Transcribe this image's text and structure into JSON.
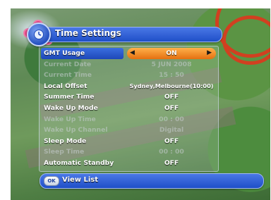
{
  "title": "Time Settings",
  "rows": [
    {
      "label": "GMT Usage",
      "value": "ON",
      "state": "selected"
    },
    {
      "label": "Current Date",
      "value": "5 JUN 2008",
      "state": "disabled"
    },
    {
      "label": "Current Time",
      "value": "15 : 50",
      "state": "disabled"
    },
    {
      "label": "Local Offset",
      "value": "Sydney,Melbourne(10:00)",
      "state": "normal"
    },
    {
      "label": "Summer Time",
      "value": "OFF",
      "state": "normal"
    },
    {
      "label": "Wake Up Mode",
      "value": "OFF",
      "state": "normal"
    },
    {
      "label": "Wake Up Time",
      "value": "00 : 00",
      "state": "disabled"
    },
    {
      "label": "Wake Up Channel",
      "value": "Digital",
      "state": "disabled"
    },
    {
      "label": "Sleep Mode",
      "value": "OFF",
      "state": "normal"
    },
    {
      "label": "Sleep Time",
      "value": "00 : 00",
      "state": "disabled"
    },
    {
      "label": "Automatic Standby",
      "value": "OFF",
      "state": "normal"
    }
  ],
  "footer": {
    "button_label": "OK",
    "action_label": "View List"
  },
  "icons": {
    "title": "clock-settings-icon",
    "left_arrow": "left-arrow-icon",
    "right_arrow": "right-arrow-icon"
  }
}
